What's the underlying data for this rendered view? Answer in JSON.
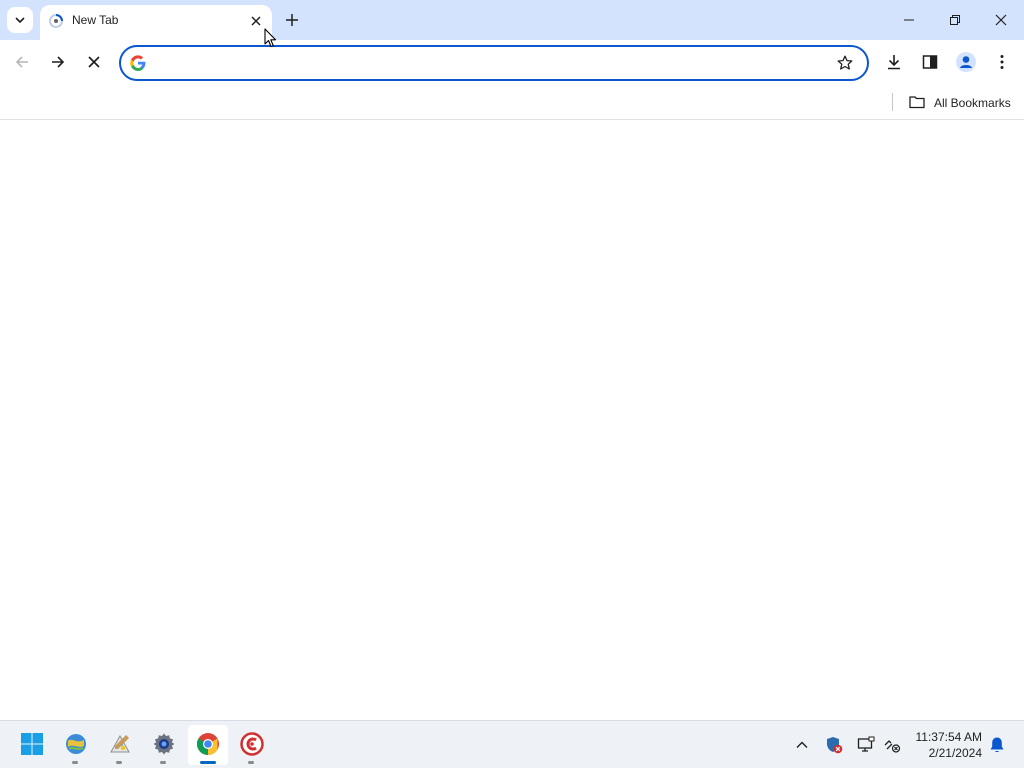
{
  "tab": {
    "title": "New Tab"
  },
  "window_controls": {
    "minimize": "minimize",
    "restore": "restore",
    "close": "close"
  },
  "omnibox": {
    "value": "",
    "placeholder": ""
  },
  "bookmarks_bar": {
    "all_bookmarks_label": "All Bookmarks"
  },
  "taskbar": {
    "apps": [
      {
        "name": "start",
        "icon": "windows-start-icon"
      },
      {
        "name": "app-1",
        "icon": "globe-app-icon"
      },
      {
        "name": "app-2",
        "icon": "paint-app-icon"
      },
      {
        "name": "settings",
        "icon": "gear-icon"
      },
      {
        "name": "chrome",
        "icon": "chrome-icon",
        "active": true
      },
      {
        "name": "app-5",
        "icon": "red-swirl-app-icon"
      }
    ],
    "clock": {
      "time": "11:37:54 AM",
      "date": "2/21/2024"
    }
  },
  "colors": {
    "titlebar": "#d3e3fd",
    "accent": "#0b57d0",
    "taskbar": "#eef2f7",
    "active_indicator": "#0067c0"
  }
}
